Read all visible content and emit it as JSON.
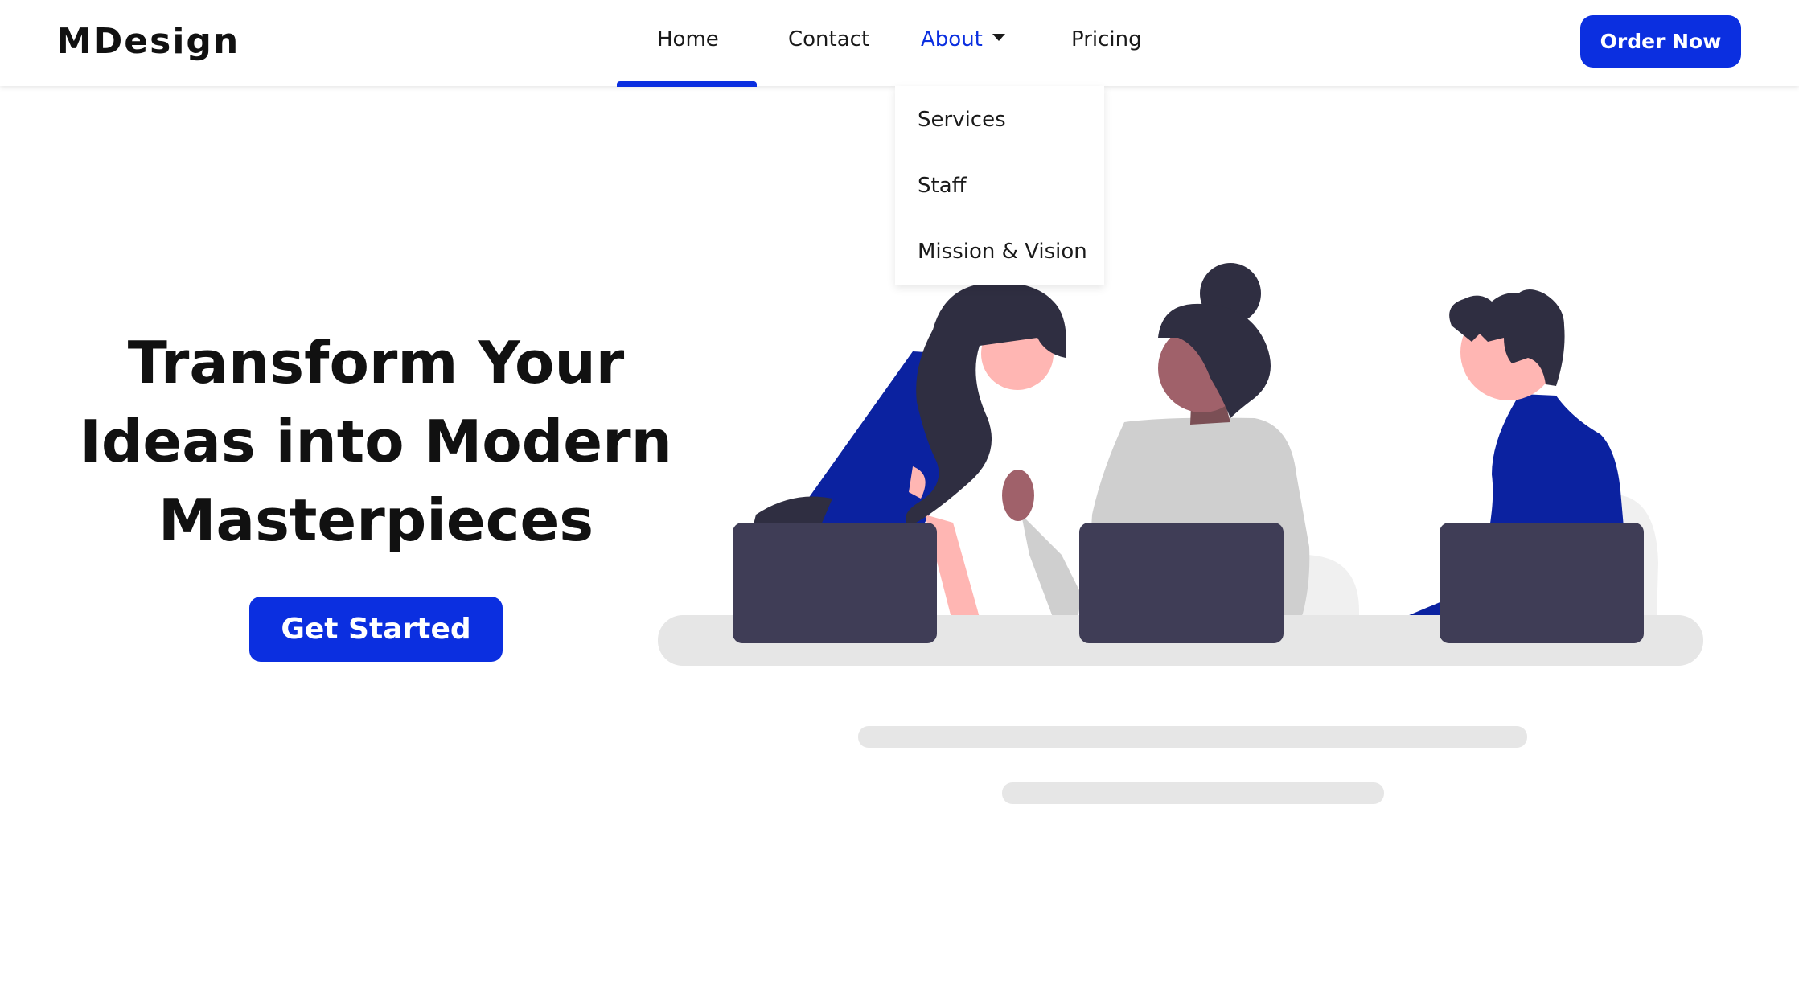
{
  "navbar": {
    "brand": "MDesign",
    "links": [
      {
        "label": "Home",
        "active": true
      },
      {
        "label": "Contact",
        "active": false
      },
      {
        "label": "About",
        "active": false,
        "open": true
      },
      {
        "label": "Pricing",
        "active": false
      }
    ],
    "cta_label": "Order Now"
  },
  "dropdown": {
    "items": [
      "Services",
      "Staff",
      "Mission & Vision"
    ]
  },
  "hero": {
    "title_lines": [
      "Transform Your",
      "Ideas into Modern",
      "Masterpieces"
    ],
    "cta_label": "Get Started"
  },
  "colors": {
    "accent": "#0b2fe0",
    "text": "#111111",
    "laptop": "#3f3d56",
    "hair": "#2f2e41",
    "skin": "#ffb6b3",
    "skin_dark": "#a0616a",
    "shirt_blue": "#0b22a0",
    "shirt_gray": "#cfcfcf",
    "table": "#e6e6e6"
  }
}
